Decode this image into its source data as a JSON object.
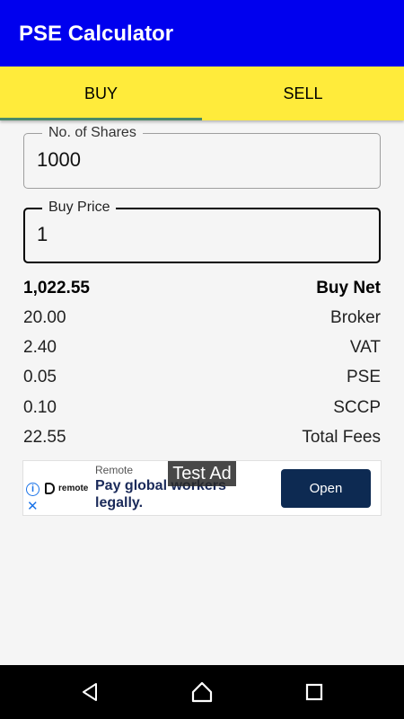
{
  "app": {
    "title": "PSE Calculator"
  },
  "tabs": [
    {
      "label": "BUY",
      "selected": true
    },
    {
      "label": "SELL",
      "selected": false
    }
  ],
  "form": {
    "shares": {
      "label": "No. of Shares",
      "value": "1000"
    },
    "price": {
      "label": "Buy Price",
      "value": "1"
    }
  },
  "results": [
    {
      "value": "1,022.55",
      "label": "Buy Net"
    },
    {
      "value": "20.00",
      "label": "Broker"
    },
    {
      "value": "2.40",
      "label": "VAT"
    },
    {
      "value": "0.05",
      "label": "PSE"
    },
    {
      "value": "0.10",
      "label": "SCCP"
    },
    {
      "value": "22.55",
      "label": "Total Fees"
    }
  ],
  "ad": {
    "badge": "Test Ad",
    "advertiser": "Remote",
    "logo_text": "remote",
    "headline": "Pay global workers legally.",
    "cta": "Open",
    "info_icon": "info-icon",
    "close_icon": "close-icon"
  },
  "navbar": {
    "icons": [
      "back-icon",
      "home-icon",
      "recents-icon"
    ]
  },
  "colors": {
    "appbar": "#0000ee",
    "tabs": "#ffeb3b",
    "tab_indicator": "#4a8a6a",
    "ad_button": "#0d2a52"
  }
}
